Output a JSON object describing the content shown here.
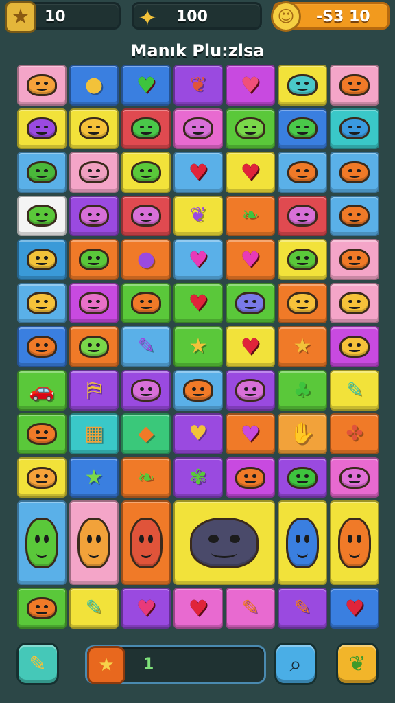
{
  "header": {
    "stars": {
      "icon": "star-icon",
      "value": "10"
    },
    "gems": {
      "icon": "gem-icon",
      "value": "100"
    },
    "coins": {
      "icon": "coin-icon",
      "value": "-S3 10"
    }
  },
  "title": "Manık Plu:zlsa",
  "board": {
    "tiles": [
      {
        "kind": "face",
        "color": "#f4a5c8",
        "glyph": "#f6a23a"
      },
      {
        "kind": "sym",
        "color": "#3a7fe0",
        "glyph": "#f2c23a",
        "sym": "●"
      },
      {
        "kind": "heart",
        "color": "#3a7fe0",
        "glyph": "#3ec43e"
      },
      {
        "kind": "sym",
        "color": "#9a4ae0",
        "glyph": "#e0543a",
        "sym": "❦"
      },
      {
        "kind": "heart",
        "color": "#c84ae0",
        "glyph": "#f0507a"
      },
      {
        "kind": "face",
        "color": "#f2e23a",
        "glyph": "#4ac8c8"
      },
      {
        "kind": "face",
        "color": "#f4a5c8",
        "glyph": "#f07a28"
      },
      {
        "kind": "face",
        "color": "#f2e23a",
        "glyph": "#9a4ae0"
      },
      {
        "kind": "face",
        "color": "#f2e23a",
        "glyph": "#f6c23a"
      },
      {
        "kind": "face",
        "color": "#e04a50",
        "glyph": "#4ac84a"
      },
      {
        "kind": "face",
        "color": "#e86ad0",
        "glyph": "#d870d8"
      },
      {
        "kind": "face",
        "color": "#5ac83a",
        "glyph": "#7ad84a"
      },
      {
        "kind": "face",
        "color": "#3a7fe0",
        "glyph": "#4ac84a"
      },
      {
        "kind": "face",
        "color": "#3ac8c8",
        "glyph": "#3a9ae0"
      },
      {
        "kind": "face",
        "color": "#5ab0e8",
        "glyph": "#4ab83a"
      },
      {
        "kind": "face",
        "color": "#f4a5c8",
        "glyph": "#f0a0c0"
      },
      {
        "kind": "face",
        "color": "#f2e23a",
        "glyph": "#5ac83a"
      },
      {
        "kind": "heart",
        "color": "#5ab0e8",
        "glyph": "#e0243a"
      },
      {
        "kind": "heart",
        "color": "#f2e23a",
        "glyph": "#e0243a"
      },
      {
        "kind": "face",
        "color": "#5ab0e8",
        "glyph": "#f07a28"
      },
      {
        "kind": "face",
        "color": "#5ab0e8",
        "glyph": "#f07a28"
      },
      {
        "kind": "face",
        "color": "#f4f4f4",
        "glyph": "#5ac83a"
      },
      {
        "kind": "face",
        "color": "#9a4ae0",
        "glyph": "#d870d8"
      },
      {
        "kind": "face",
        "color": "#e04a50",
        "glyph": "#d870d8"
      },
      {
        "kind": "sym",
        "color": "#f2e23a",
        "glyph": "#9a4ae0",
        "sym": "❦"
      },
      {
        "kind": "sym",
        "color": "#f07a28",
        "glyph": "#3ec43e",
        "sym": "❧"
      },
      {
        "kind": "face",
        "color": "#e04a50",
        "glyph": "#d870d8"
      },
      {
        "kind": "face",
        "color": "#5ab0e8",
        "glyph": "#f07a28"
      },
      {
        "kind": "face",
        "color": "#3a9ad8",
        "glyph": "#f2c23a"
      },
      {
        "kind": "face",
        "color": "#f07a28",
        "glyph": "#5ac83a"
      },
      {
        "kind": "sym",
        "color": "#f07a28",
        "glyph": "#9a4ae0",
        "sym": "●"
      },
      {
        "kind": "heart",
        "color": "#5ab0e8",
        "glyph": "#e83ab8"
      },
      {
        "kind": "heart",
        "color": "#f07a28",
        "glyph": "#e83ab8"
      },
      {
        "kind": "face",
        "color": "#f2e23a",
        "glyph": "#5ac83a"
      },
      {
        "kind": "face",
        "color": "#f4a5c8",
        "glyph": "#f07a28"
      },
      {
        "kind": "face",
        "color": "#5ab0e8",
        "glyph": "#f6c23a"
      },
      {
        "kind": "face",
        "color": "#c84ae0",
        "glyph": "#e870c8"
      },
      {
        "kind": "face",
        "color": "#5ac83a",
        "glyph": "#f07a28"
      },
      {
        "kind": "heart",
        "color": "#5ac83a",
        "glyph": "#e0243a"
      },
      {
        "kind": "face",
        "color": "#5ac83a",
        "glyph": "#7a7ae8"
      },
      {
        "kind": "face",
        "color": "#f07a28",
        "glyph": "#f6c23a"
      },
      {
        "kind": "face",
        "color": "#f4a5c8",
        "glyph": "#f6c23a"
      },
      {
        "kind": "face",
        "color": "#3a7fe0",
        "glyph": "#f07a28"
      },
      {
        "kind": "face",
        "color": "#f07a28",
        "glyph": "#7ad84a"
      },
      {
        "kind": "sym",
        "color": "#5ab0e8",
        "glyph": "#9a4ae0",
        "sym": "✎"
      },
      {
        "kind": "sym",
        "color": "#5ac83a",
        "glyph": "#f2c23a",
        "sym": "★"
      },
      {
        "kind": "heart",
        "color": "#f2e23a",
        "glyph": "#e0243a"
      },
      {
        "kind": "sym",
        "color": "#f07a28",
        "glyph": "#f2c23a",
        "sym": "★"
      },
      {
        "kind": "face",
        "color": "#c84ae0",
        "glyph": "#f6c23a"
      },
      {
        "kind": "sym",
        "color": "#5ac83a",
        "glyph": "#3a9ad8",
        "sym": "🚗"
      },
      {
        "kind": "sym",
        "color": "#9a4ae0",
        "glyph": "#f2c23a",
        "sym": "⛿"
      },
      {
        "kind": "face",
        "color": "#9a4ae0",
        "glyph": "#d870d8"
      },
      {
        "kind": "face",
        "color": "#5ab0e8",
        "glyph": "#f07a28"
      },
      {
        "kind": "face",
        "color": "#9a4ae0",
        "glyph": "#d870d8"
      },
      {
        "kind": "sym",
        "color": "#5ac83a",
        "glyph": "#3ec43e",
        "sym": "♣"
      },
      {
        "kind": "sym",
        "color": "#f2e23a",
        "glyph": "#4ac8a0",
        "sym": "✎"
      },
      {
        "kind": "face",
        "color": "#5ac83a",
        "glyph": "#f07a28"
      },
      {
        "kind": "sym",
        "color": "#3ac8c8",
        "glyph": "#f2a23a",
        "sym": "▦"
      },
      {
        "kind": "sym",
        "color": "#3ac87a",
        "glyph": "#f07a28",
        "sym": "◆"
      },
      {
        "kind": "sym",
        "color": "#9a4ae0",
        "glyph": "#f2c23a",
        "sym": "♥"
      },
      {
        "kind": "heart",
        "color": "#f07a28",
        "glyph": "#c84ae0"
      },
      {
        "kind": "sym",
        "color": "#f2a23a",
        "glyph": "#3a9ae0",
        "sym": "✋"
      },
      {
        "kind": "sym",
        "color": "#f07a28",
        "glyph": "#e0543a",
        "sym": "✤"
      },
      {
        "kind": "face",
        "color": "#f2e23a",
        "glyph": "#f6a23a"
      },
      {
        "kind": "sym",
        "color": "#3a7fe0",
        "glyph": "#7ad84a",
        "sym": "★"
      },
      {
        "kind": "sym",
        "color": "#f07a28",
        "glyph": "#5ac83a",
        "sym": "❧"
      },
      {
        "kind": "sym",
        "color": "#9a4ae0",
        "glyph": "#5ac83a",
        "sym": "✾"
      },
      {
        "kind": "face",
        "color": "#c84ae0",
        "glyph": "#f07a28"
      },
      {
        "kind": "face",
        "color": "#9a4ae0",
        "glyph": "#3ec43e"
      },
      {
        "kind": "face",
        "color": "#e86ad0",
        "glyph": "#e070d8"
      },
      {
        "kind": "face",
        "color": "#5ab0e8",
        "glyph": "#5ac83a",
        "tall": true
      },
      {
        "kind": "face",
        "color": "#f4a5c8",
        "glyph": "#f2a23a",
        "tall": true
      },
      {
        "kind": "face",
        "color": "#f07a28",
        "glyph": "#e0543a",
        "tall": true
      },
      {
        "kind": "face",
        "color": "#f2e23a",
        "glyph": "#4a4a6a",
        "wide": true
      },
      {
        "kind": "face",
        "color": "#f2e23a",
        "glyph": "#3a7fe0",
        "tall": true
      },
      {
        "kind": "face",
        "color": "#f2e23a",
        "glyph": "#f07a28",
        "tall": true
      },
      {
        "kind": "face",
        "color": "#5ac83a",
        "glyph": "#f07a28"
      },
      {
        "kind": "sym",
        "color": "#f2e23a",
        "glyph": "#4ac8a0",
        "sym": "✎"
      },
      {
        "kind": "heart",
        "color": "#9a4ae0",
        "glyph": "#e83a7a"
      },
      {
        "kind": "heart",
        "color": "#e86ad0",
        "glyph": "#e0243a"
      },
      {
        "kind": "sym",
        "color": "#e86ad0",
        "glyph": "#f07a28",
        "sym": "✎"
      },
      {
        "kind": "sym",
        "color": "#9a4ae0",
        "glyph": "#f07a28",
        "sym": "✎"
      },
      {
        "kind": "heart",
        "color": "#3a7fe0",
        "glyph": "#e0243a"
      }
    ]
  },
  "footer": {
    "pencil": "pencil-icon",
    "progress": {
      "icon": "star-icon",
      "value": "1"
    },
    "search": "search-icon",
    "leaf": "leaf-icon"
  }
}
